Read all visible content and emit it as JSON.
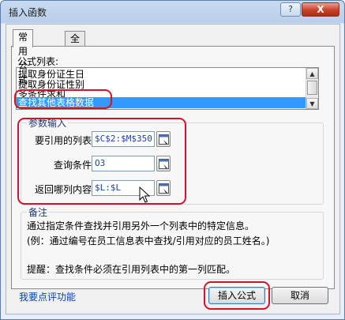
{
  "window": {
    "title": "插入函数",
    "help_label": "?",
    "close_label": "X"
  },
  "tabs": [
    {
      "label": "常用公式",
      "active": true
    },
    {
      "label": "全部函数",
      "active": false
    }
  ],
  "formula_list": {
    "label": "公式列表:",
    "items": [
      {
        "label": "提取身份证生日",
        "selected": false
      },
      {
        "label": "提取身份证性别",
        "selected": false
      },
      {
        "label": "多条件求和",
        "selected": false
      },
      {
        "label": "查找其他表格数据",
        "selected": true
      }
    ]
  },
  "params": {
    "title": "参数输入",
    "fields": [
      {
        "label": "要引用的列表",
        "value": "$C$2:$M$350"
      },
      {
        "label": "查询条件",
        "value": "O3"
      },
      {
        "label": "返回哪列内容",
        "value": "$L:$L"
      }
    ]
  },
  "note": {
    "title": "备注",
    "lines": [
      "通过指定条件查找并引用另外一个列表中的特定信息。",
      "(例：通过编号在员工信息表中查找/引用对应的员工姓名。)",
      "",
      "提醒：查找条件必须在引用列表中的第一列匹配。"
    ]
  },
  "footer": {
    "feedback_link": "我要点评功能",
    "insert_button": "插入公式",
    "cancel_button": "取消"
  },
  "colors": {
    "highlight_ring": "#d3132a",
    "selection": "#3399ff",
    "link": "#0645ad"
  }
}
